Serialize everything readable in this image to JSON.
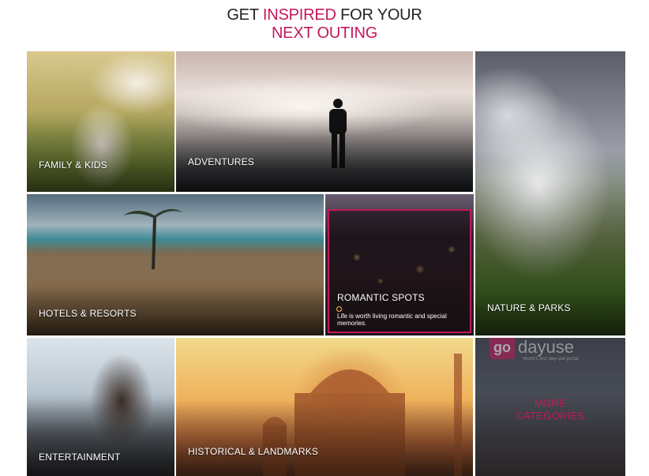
{
  "header": {
    "line1_prefix": "GET ",
    "line1_accent": "INSPIRED",
    "line1_suffix": " FOR YOUR",
    "line2": "NEXT OUTING"
  },
  "tiles": {
    "family": {
      "label": "FAMILY & KIDS"
    },
    "adventures": {
      "label": "ADVENTURES"
    },
    "nature": {
      "label": "NATURE & PARKS"
    },
    "hotels": {
      "label": "HOTELS & RESORTS"
    },
    "romantic": {
      "label": "ROMANTIC SPOTS",
      "description": "Life is worth living romantic and special memories."
    },
    "entertainment": {
      "label": "ENTERTAINMENT"
    },
    "historical": {
      "label": "HISTORICAL & LANDMARKS"
    },
    "more": {
      "logo_go": "go",
      "logo_word": "dayuse",
      "tagline": "World's first day-use portal",
      "label_line1": "MORE",
      "label_line2": "CATEGORIES"
    }
  },
  "colors": {
    "accent": "#c2185b",
    "title": "#222222",
    "tile_label": "#ffffff"
  }
}
